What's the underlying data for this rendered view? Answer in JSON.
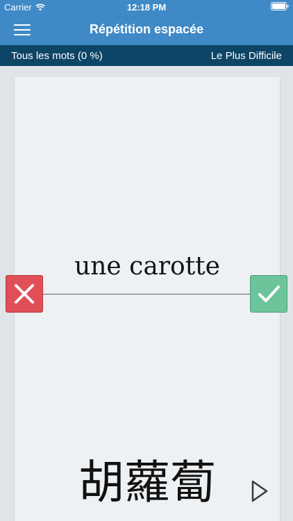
{
  "status_bar": {
    "carrier": "Carrier",
    "time": "12:18 PM",
    "wifi_icon": "wifi-icon",
    "battery_icon": "battery-icon"
  },
  "nav": {
    "title": "Répétition espacée",
    "menu_icon": "hamburger-menu-icon"
  },
  "subbar": {
    "left_label": "Tous les mots (0 %)",
    "right_label": "Le Plus Difficile"
  },
  "card": {
    "word": "une carotte",
    "translation": "胡蘿蔔"
  },
  "controls": {
    "wrong_icon": "cross-icon",
    "right_icon": "checkmark-icon",
    "play_icon": "play-icon"
  },
  "colors": {
    "nav_blue": "#3f8ac6",
    "subbar_navy": "#0d4566",
    "wrong_red": "#df4f55",
    "right_green": "#6cc49a"
  }
}
